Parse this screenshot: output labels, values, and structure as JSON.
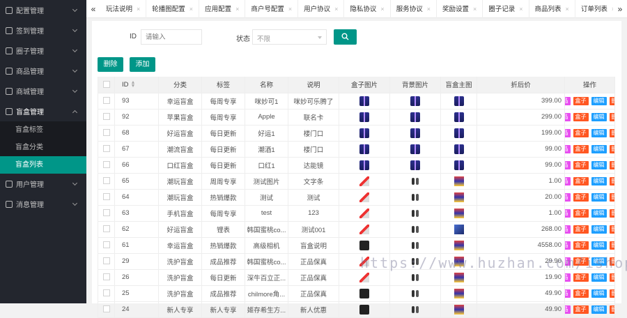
{
  "sidebar": {
    "menus": [
      {
        "label": "配置管理",
        "icon": "settings-icon"
      },
      {
        "label": "签到管理",
        "icon": "calendar-icon"
      },
      {
        "label": "圈子管理",
        "icon": "users-icon"
      },
      {
        "label": "商品管理",
        "icon": "goods-icon"
      },
      {
        "label": "商城管理",
        "icon": "shop-icon"
      },
      {
        "label": "盲盒管理",
        "icon": "box-icon"
      }
    ],
    "box_submenu": [
      "盲盒标签",
      "盲盒分类",
      "盲盒列表"
    ],
    "after_menus": [
      {
        "label": "用户管理",
        "icon": "user-icon"
      },
      {
        "label": "消息管理",
        "icon": "message-icon"
      }
    ]
  },
  "tabs": {
    "prev": "«",
    "next": "»",
    "items": [
      "玩法说明",
      "轮播图配置",
      "应用配置",
      "商户号配置",
      "用户协议",
      "隐私协议",
      "服务协议",
      "奖励设置",
      "圈子记录",
      "商品列表",
      "订单列表"
    ]
  },
  "filter": {
    "id_label": "ID",
    "id_placeholder": "请输入",
    "status_label": "状态",
    "status_value": "不限"
  },
  "actions": {
    "delete": "删除",
    "add": "添加"
  },
  "table": {
    "headers": [
      "ID",
      "分类",
      "标签",
      "名称",
      "说明",
      "盒子图片",
      "背景图片",
      "盲盒主图",
      "折后价",
      "操作"
    ],
    "op_labels": [
      "商品",
      "盒子",
      "编辑",
      "删除"
    ],
    "rows": [
      [
        "93",
        "幸运盲盒",
        "每周专享",
        "咪妙可1",
        "咪妙可乐腾了",
        "gift",
        "gift",
        "gift",
        "399.00"
      ],
      [
        "92",
        "苹果盲盒",
        "每周专享",
        "Apple",
        "联名卡",
        "gift",
        "gift",
        "gift",
        "299.00"
      ],
      [
        "68",
        "好运盲盒",
        "每日更新",
        "好运1",
        "楼门口",
        "gift",
        "gift",
        "gift",
        "199.00"
      ],
      [
        "67",
        "潮流盲盒",
        "每日更新",
        "潮酒1",
        "楼门口",
        "gift",
        "gift",
        "gift",
        "99.00"
      ],
      [
        "66",
        "口红盲盒",
        "每日更新",
        "口红1",
        "达能镜",
        "gift",
        "gift",
        "gift",
        "99.00"
      ],
      [
        "65",
        "潮玩盲盒",
        "周周专享",
        "测试图片",
        "文字条",
        "pack",
        "fig",
        "poster",
        "1.00"
      ],
      [
        "64",
        "潮玩盲盒",
        "热销爆款",
        "测试",
        "测试",
        "pack",
        "fig",
        "poster",
        "20.00"
      ],
      [
        "63",
        "手机盲盒",
        "每周专享",
        "test",
        "123",
        "pack",
        "fig",
        "poster",
        "1.00"
      ],
      [
        "62",
        "好运盲盒",
        "锂表",
        "韩国蜜桃co...",
        "测试001",
        "pack",
        "fig",
        "blue",
        "268.00"
      ],
      [
        "61",
        "幸运盲盒",
        "热销爆款",
        "高级相机",
        "盲盒说明",
        "dark",
        "fig",
        "poster",
        "4558.00"
      ],
      [
        "29",
        "洗护盲盒",
        "成品推荐",
        "韩国蜜桃co...",
        "正品保真",
        "pack",
        "fig",
        "poster",
        "29.90"
      ],
      [
        "26",
        "洗护盲盒",
        "每日更新",
        "深牛百立正...",
        "正品保真",
        "pack",
        "fig",
        "poster",
        "19.90"
      ],
      [
        "25",
        "洗护盲盒",
        "成品推荐",
        "chilmore角...",
        "正品保真",
        "dark",
        "fig",
        "poster",
        "49.90"
      ],
      [
        "24",
        "新人专享",
        "新人专享",
        "姬存希生方...",
        "新人优惠",
        "dark",
        "fig",
        "poster",
        "49.90"
      ]
    ]
  },
  "watermark": "https://www.huzhan.com/ishop15665",
  "colors": {
    "primary": "#009688",
    "sidebar": "#23262e",
    "product_btn": "#e84ef0",
    "box_btn": "#ff5722",
    "edit_btn": "#1e9fff",
    "delete_btn": "#ff5722"
  }
}
